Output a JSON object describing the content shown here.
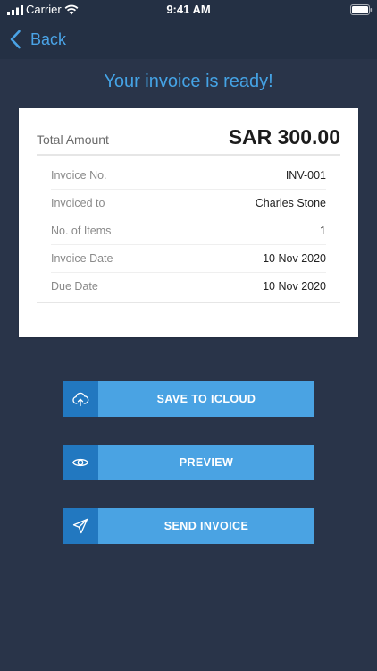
{
  "status_bar": {
    "carrier": "Carrier",
    "time": "9:41 AM"
  },
  "nav": {
    "back_label": "Back"
  },
  "headline": "Your invoice is ready!",
  "invoice": {
    "total_label": "Total Amount",
    "total_value": "SAR 300.00",
    "rows": [
      {
        "label": "Invoice No.",
        "value": "INV-001"
      },
      {
        "label": "Invoiced to",
        "value": "Charles Stone"
      },
      {
        "label": "No. of Items",
        "value": "1"
      },
      {
        "label": "Invoice Date",
        "value": "10 Nov 2020"
      },
      {
        "label": "Due Date",
        "value": "10 Nov 2020"
      }
    ]
  },
  "actions": [
    {
      "label": "SAVE TO ICLOUD",
      "icon": "cloud-upload-icon"
    },
    {
      "label": "PREVIEW",
      "icon": "eye-icon"
    },
    {
      "label": "SEND INVOICE",
      "icon": "paper-plane-icon"
    }
  ],
  "colors": {
    "background": "#293449",
    "accent": "#4aa3e3",
    "accent_dark": "#2278c0"
  }
}
